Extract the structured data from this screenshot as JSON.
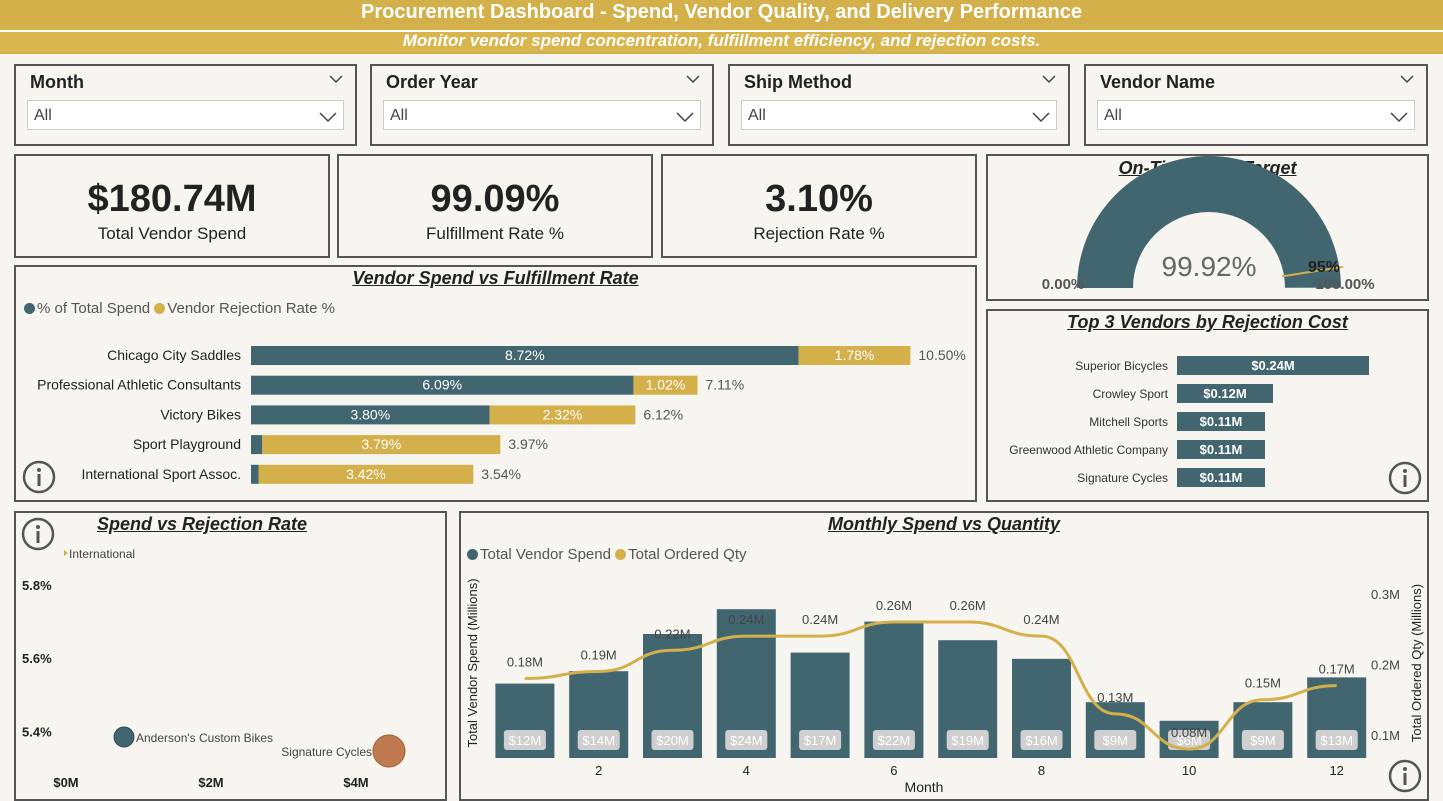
{
  "header": {
    "title": "Procurement Dashboard - Spend, Vendor Quality, and Delivery Performance",
    "subtitle": "Monitor vendor spend concentration, fulfillment efficiency, and rejection costs."
  },
  "filters": [
    {
      "label": "Month",
      "value": "All"
    },
    {
      "label": "Order Year",
      "value": "All"
    },
    {
      "label": "Ship Method",
      "value": "All"
    },
    {
      "label": "Vendor Name",
      "value": "All"
    }
  ],
  "kpis": [
    {
      "value": "$180.74M",
      "label": "Total Vendor Spend"
    },
    {
      "value": "99.09%",
      "label": "Fulfillment Rate %"
    },
    {
      "value": "3.10%",
      "label": "Rejection Rate %"
    }
  ],
  "gauge": {
    "title": "On-Time % vs Target",
    "value_text": "99.92%",
    "value": 99.92,
    "min_label": "0.00%",
    "max_label": "100.00%",
    "target_label": "95%",
    "target": 95,
    "color": "#41666f",
    "target_color": "#d4b04a"
  },
  "colors": {
    "teal": "#41666f",
    "gold": "#d4b04a",
    "brown": "#c07a50"
  },
  "chart_data": [
    {
      "type": "bar",
      "title": "Vendor Spend vs Fulfillment Rate",
      "orientation": "horizontal-stacked",
      "categories": [
        "Chicago City Saddles",
        "Professional Athletic Consultants",
        "Victory Bikes",
        "Sport Playground",
        "International Sport Assoc."
      ],
      "series": [
        {
          "name": "% of Total Spend",
          "values": [
            8.72,
            6.09,
            3.8,
            0.18,
            0.12
          ],
          "labels": [
            "8.72%",
            "6.09%",
            "3.80%",
            "",
            ""
          ]
        },
        {
          "name": "Vendor Rejection Rate %",
          "values": [
            1.78,
            1.02,
            2.32,
            3.79,
            3.42
          ],
          "labels": [
            "1.78%",
            "1.02%",
            "2.32%",
            "3.79%",
            "3.42%"
          ]
        }
      ],
      "totals": [
        "10.50%",
        "7.11%",
        "6.12%",
        "3.97%",
        "3.54%"
      ],
      "legend": "top-left"
    },
    {
      "type": "bar",
      "title": "Top 3 Vendors by Rejection Cost",
      "orientation": "horizontal",
      "categories": [
        "Superior Bicycles",
        "Crowley Sport",
        "Mitchell Sports",
        "Greenwood Athletic Company",
        "Signature Cycles"
      ],
      "values": [
        0.24,
        0.12,
        0.11,
        0.11,
        0.11
      ],
      "labels": [
        "$0.24M",
        "$0.12M",
        "$0.11M",
        "$0.11M",
        "$0.11M"
      ]
    },
    {
      "type": "scatter",
      "title": "Spend vs Rejection Rate",
      "xticks": [
        "$0M",
        "$2M",
        "$4M"
      ],
      "yticks": [
        "5.8%",
        "5.6%",
        "5.4%"
      ],
      "xlim": [
        0,
        4.4
      ],
      "ylim": [
        5.3,
        5.9
      ],
      "points": [
        {
          "label": "International",
          "x": 0.0,
          "y": 5.89,
          "size": 3,
          "color": "#d4b04a"
        },
        {
          "label": "Anderson's Custom Bikes",
          "x": 0.8,
          "y": 5.39,
          "size": 10,
          "color": "#41666f"
        },
        {
          "label": "Signature Cycles",
          "x": 4.45,
          "y": 5.35,
          "size": 16,
          "color": "#c07a50"
        }
      ]
    },
    {
      "type": "bar",
      "title": "Monthly Spend vs Quantity",
      "subtype": "combo-bar-line",
      "categories": [
        "1",
        "2",
        "3",
        "4",
        "5",
        "6",
        "7",
        "8",
        "9",
        "10",
        "11",
        "12"
      ],
      "xticks": [
        "2",
        "4",
        "6",
        "8",
        "10",
        "12"
      ],
      "xlabel": "Month",
      "ylabel": "Total Vendor Spend (Millions)",
      "ylabel_right": "Total Ordered Qty (Millions)",
      "yticks_right": [
        "0.3M",
        "0.2M",
        "0.1M"
      ],
      "ylim_right": [
        0,
        0.3
      ],
      "series": [
        {
          "name": "Total Vendor Spend",
          "values": [
            12,
            14,
            20,
            24,
            17,
            22,
            19,
            16,
            9,
            6,
            9,
            13
          ],
          "labels": [
            "$12M",
            "$14M",
            "$20M",
            "$24M",
            "$17M",
            "$22M",
            "$19M",
            "$16M",
            "$9M",
            "$6M",
            "$9M",
            "$13M"
          ]
        },
        {
          "name": "Total Ordered Qty",
          "values": [
            0.18,
            0.19,
            0.22,
            0.24,
            0.24,
            0.26,
            0.26,
            0.24,
            0.13,
            0.08,
            0.15,
            0.17
          ],
          "labels": [
            "0.18M",
            "0.19M",
            "0.22M",
            "0.24M",
            "0.24M",
            "0.26M",
            "0.26M",
            "0.24M",
            "0.13M",
            "0.08M",
            "0.15M",
            "0.17M"
          ]
        }
      ],
      "ylim": [
        0,
        30
      ],
      "legend": "top-left"
    }
  ]
}
